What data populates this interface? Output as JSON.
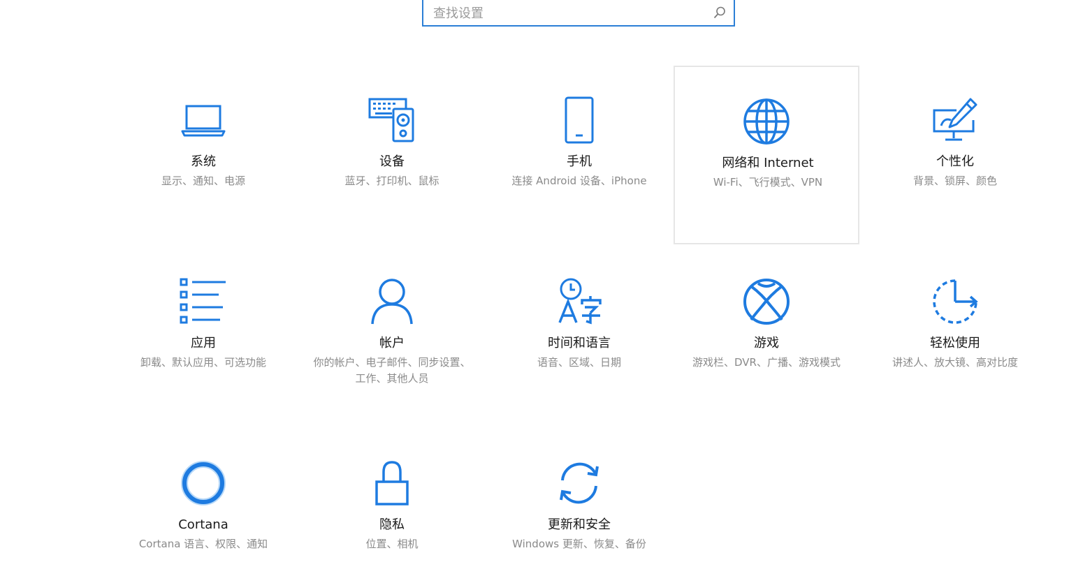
{
  "search": {
    "placeholder": "查找设置"
  },
  "colors": {
    "accent": "#1e7be0",
    "selected_border": "#e6e6e6",
    "title": "#1a1a1a",
    "description": "#8a8a8a"
  },
  "tiles": [
    {
      "icon": "laptop-icon",
      "title": "系统",
      "desc": "显示、通知、电源"
    },
    {
      "icon": "devices-icon",
      "title": "设备",
      "desc": "蓝牙、打印机、鼠标"
    },
    {
      "icon": "phone-icon",
      "title": "手机",
      "desc": "连接 Android 设备、iPhone"
    },
    {
      "icon": "globe-icon",
      "title": "网络和 Internet",
      "desc": "Wi-Fi、飞行模式、VPN"
    },
    {
      "icon": "personalization-icon",
      "title": "个性化",
      "desc": "背景、锁屏、颜色"
    },
    {
      "icon": "apps-list-icon",
      "title": "应用",
      "desc": "卸载、默认应用、可选功能"
    },
    {
      "icon": "person-icon",
      "title": "帐户",
      "desc": "你的帐户、电子邮件、同步设置、工作、其他人员"
    },
    {
      "icon": "time-language-icon",
      "title": "时间和语言",
      "desc": "语音、区域、日期"
    },
    {
      "icon": "xbox-icon",
      "title": "游戏",
      "desc": "游戏栏、DVR、广播、游戏模式"
    },
    {
      "icon": "ease-of-access-icon",
      "title": "轻松使用",
      "desc": "讲述人、放大镜、高对比度"
    },
    {
      "icon": "cortana-icon",
      "title": "Cortana",
      "desc": "Cortana 语言、权限、通知"
    },
    {
      "icon": "lock-icon",
      "title": "隐私",
      "desc": "位置、相机"
    },
    {
      "icon": "sync-icon",
      "title": "更新和安全",
      "desc": "Windows 更新、恢复、备份"
    }
  ]
}
